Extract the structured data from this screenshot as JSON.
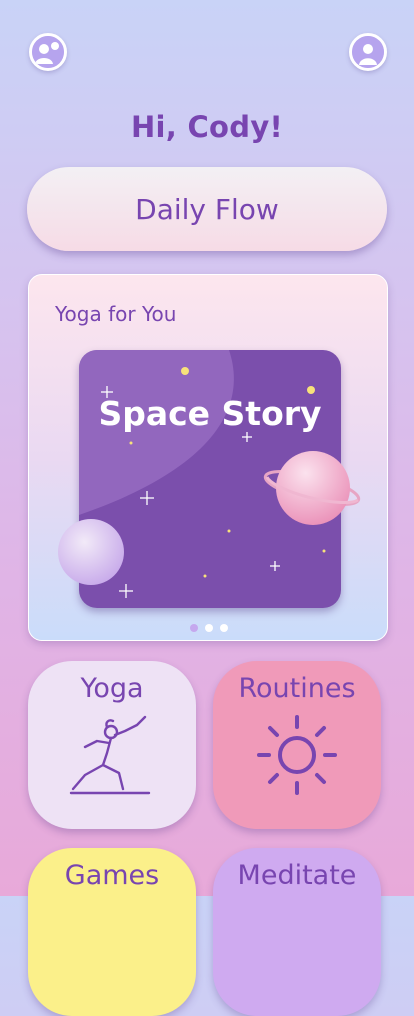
{
  "header": {
    "left_avatar_icon": "user-profile-icon",
    "right_avatar_icon": "user-profile-icon"
  },
  "greeting": "Hi, Cody!",
  "daily_button": {
    "label": "Daily Flow"
  },
  "yoga_card": {
    "title": "Yoga for You",
    "story_title": "Space Story",
    "carousel": {
      "pages": 3,
      "active": 1
    }
  },
  "tiles": [
    {
      "label": "Yoga",
      "icon": "yoga-pose-icon",
      "color": "#eee2f5"
    },
    {
      "label": "Routines",
      "icon": "sun-icon",
      "color": "#f09ab9"
    },
    {
      "label": "Games",
      "color": "#fbf08a"
    },
    {
      "label": "Meditate",
      "color": "#cfaaf0"
    }
  ],
  "colors": {
    "accent": "#7845b0",
    "story_bg": "#7b4fac"
  }
}
